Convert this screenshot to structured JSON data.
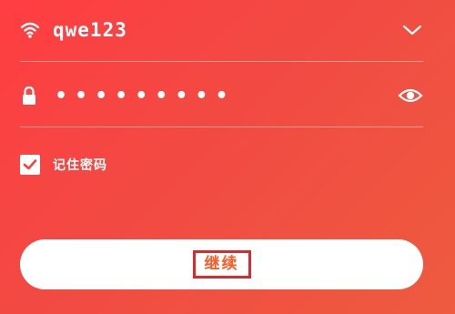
{
  "network": {
    "ssid": "qwe123",
    "wifi_icon": "wifi-icon",
    "dropdown_icon": "chevron-down-icon"
  },
  "password": {
    "masked_value": "•••••••••",
    "lock_icon": "lock-icon",
    "reveal_icon": "eye-icon"
  },
  "remember": {
    "label": "记住密码",
    "checked": true
  },
  "continue_button": {
    "label": "继续"
  },
  "colors": {
    "background_start": "#ff3d42",
    "background_end": "#ee5b3f",
    "button_text": "#ff5a24",
    "highlight_border": "#e0282a"
  }
}
